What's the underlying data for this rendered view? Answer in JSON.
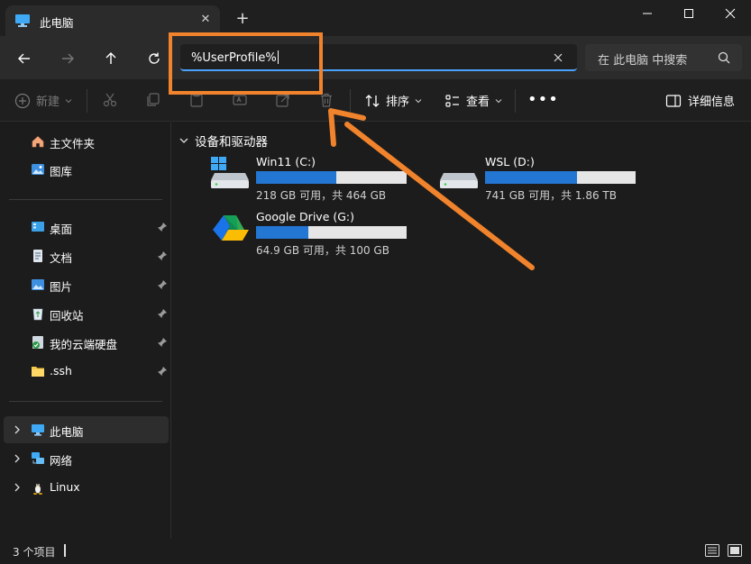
{
  "window": {
    "tab_title": "此电脑",
    "new_tab_icon": "plus-icon"
  },
  "address_bar": {
    "value": "%UserProfile%",
    "search_placeholder": "在 此电脑 中搜索"
  },
  "toolbar": {
    "new_label": "新建",
    "sort_label": "排序",
    "view_label": "查看",
    "more_label": "•••",
    "details_label": "详细信息"
  },
  "sidebar": {
    "top_items": [
      {
        "label": "主文件夹",
        "icon": "home-icon"
      },
      {
        "label": "图库",
        "icon": "gallery-icon"
      }
    ],
    "pinned_items": [
      {
        "label": "桌面",
        "icon": "desktop-icon"
      },
      {
        "label": "文档",
        "icon": "documents-icon"
      },
      {
        "label": "图片",
        "icon": "pictures-icon"
      },
      {
        "label": "回收站",
        "icon": "recycle-bin-icon"
      },
      {
        "label": "我的云端硬盘",
        "icon": "cloud-drive-icon"
      },
      {
        "label": ".ssh",
        "icon": "folder-icon"
      }
    ],
    "tree_items": [
      {
        "label": "此电脑",
        "icon": "this-pc-icon",
        "selected": true
      },
      {
        "label": "网络",
        "icon": "network-icon",
        "selected": false
      },
      {
        "label": "Linux",
        "icon": "linux-icon",
        "selected": false
      }
    ]
  },
  "content": {
    "section_title": "设备和驱动器",
    "drives": [
      {
        "name": "Win11 (C:)",
        "info": "218 GB 可用，共 464 GB",
        "used_fraction": 0.53,
        "icon": "windows-drive-icon"
      },
      {
        "name": "WSL (D:)",
        "info": "741 GB 可用，共 1.86 TB",
        "used_fraction": 0.61,
        "icon": "hard-drive-icon"
      },
      {
        "name": "Google Drive (G:)",
        "info": "64.9 GB 可用，共 100 GB",
        "used_fraction": 0.35,
        "icon": "google-drive-icon"
      }
    ]
  },
  "statusbar": {
    "item_count": "3 个项目"
  },
  "colors": {
    "accent": "#4aa3ff",
    "bar_fill": "#2476d3",
    "annotation": "#f0832c"
  }
}
